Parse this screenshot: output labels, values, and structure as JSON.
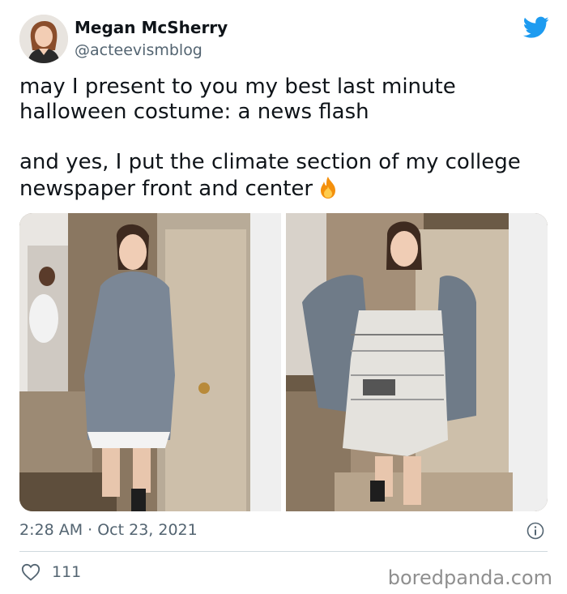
{
  "author": {
    "name": "Megan McSherry",
    "handle": "@acteevismblog"
  },
  "tweet": {
    "line1": "may I present to you my best last minute halloween costume: a news flash",
    "line2": "and yes, I put the climate section of my college newspaper front and center",
    "emoji": "fire-emoji"
  },
  "meta": {
    "timestamp": "2:28 AM · Oct 23, 2021"
  },
  "engagement": {
    "likes": "111"
  },
  "watermark": "boredpanda.com",
  "colors": {
    "twitter_blue": "#1d9bf0",
    "secondary_text": "#536471"
  }
}
